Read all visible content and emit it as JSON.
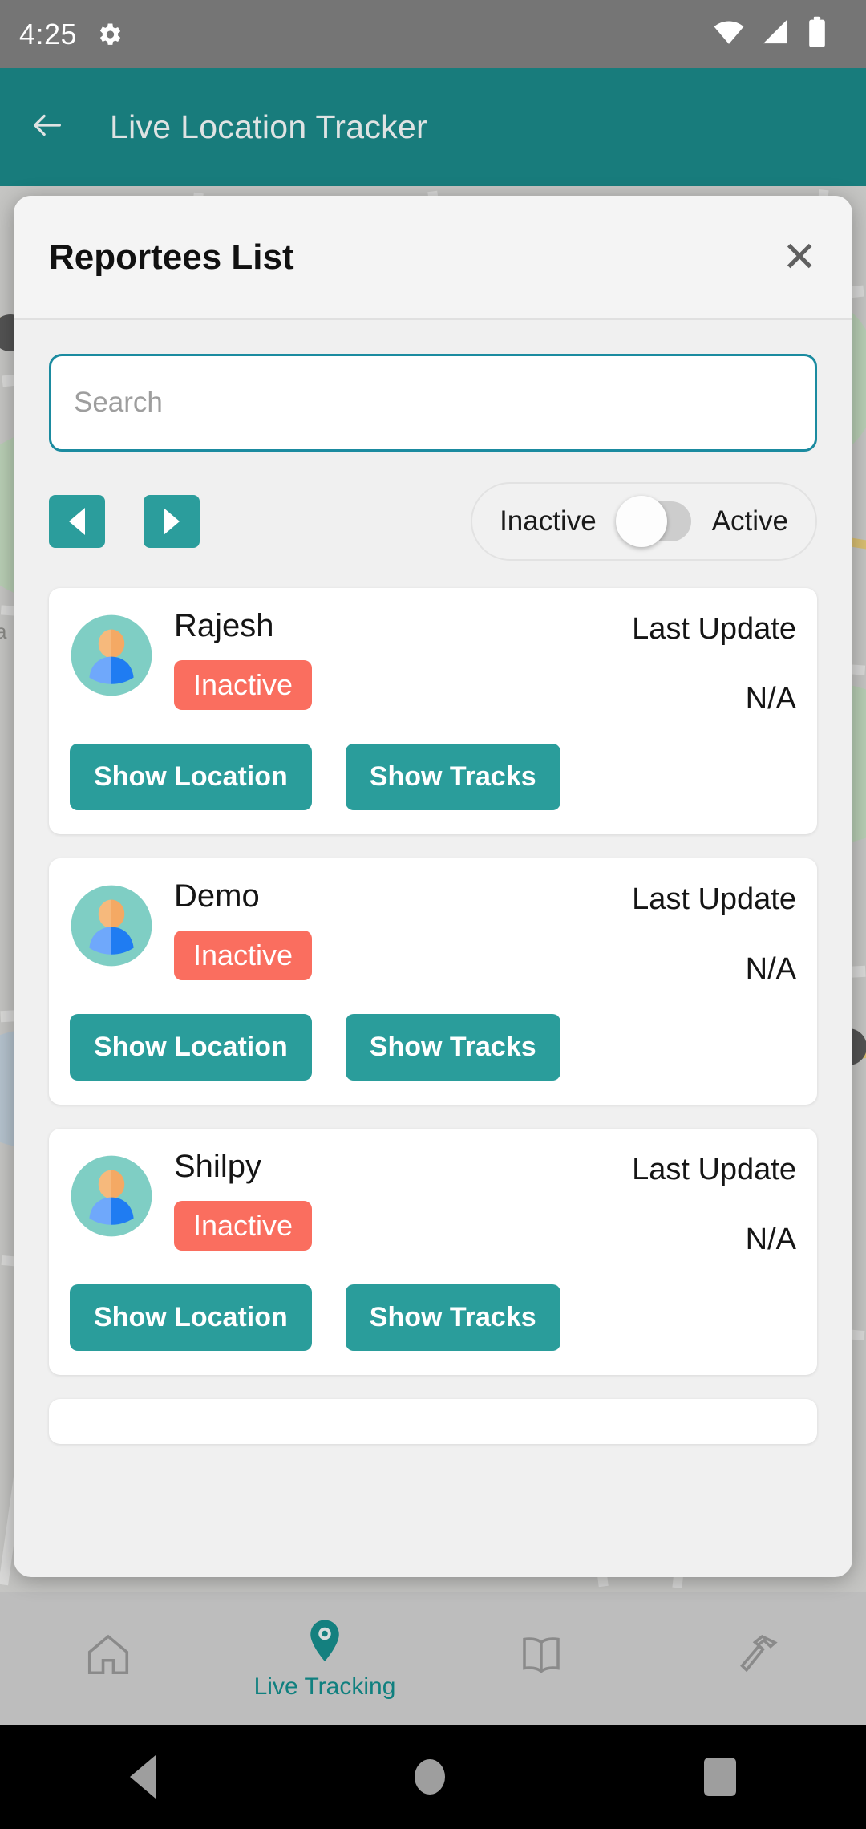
{
  "status_bar": {
    "time": "4:25",
    "left_icons": [
      "gear-icon"
    ],
    "right_icons": [
      "wifi-icon",
      "cellular-signal-icon",
      "battery-icon"
    ]
  },
  "app_bar": {
    "back_icon": "arrow-left-icon",
    "title": "Live Location Tracker"
  },
  "dialog": {
    "title": "Reportees List",
    "close_icon": "close-icon",
    "search": {
      "placeholder": "Search",
      "value": ""
    },
    "pagination": {
      "prev_icon": "chevron-left-icon",
      "next_icon": "chevron-right-icon"
    },
    "status_toggle": {
      "left_label": "Inactive",
      "right_label": "Active",
      "selected": "Inactive",
      "knob_position": "left"
    },
    "reportees": [
      {
        "name": "Rajesh",
        "status": "Inactive",
        "last_update_label": "Last Update",
        "last_update_value": "N/A",
        "show_location_label": "Show Location",
        "show_tracks_label": "Show Tracks"
      },
      {
        "name": "Demo",
        "status": "Inactive",
        "last_update_label": "Last Update",
        "last_update_value": "N/A",
        "show_location_label": "Show Location",
        "show_tracks_label": "Show Tracks"
      },
      {
        "name": "Shilpy",
        "status": "Inactive",
        "last_update_label": "Last Update",
        "last_update_value": "N/A",
        "show_location_label": "Show Location",
        "show_tracks_label": "Show Tracks"
      }
    ]
  },
  "bottom_nav": {
    "items": [
      {
        "icon": "home-icon",
        "label": "",
        "active": false
      },
      {
        "icon": "location-pin-icon",
        "label": "Live Tracking",
        "active": true
      },
      {
        "icon": "book-icon",
        "label": "",
        "active": false
      },
      {
        "icon": "hammer-icon",
        "label": "",
        "active": false
      }
    ]
  },
  "android_nav": {
    "back_icon": "android-back-icon",
    "home_icon": "android-home-icon",
    "recents_icon": "android-recents-icon"
  },
  "colors": {
    "app_bar": "#187c7c",
    "accent_teal": "#2a9d9b",
    "badge_inactive": "#fa6e5f",
    "search_border": "#1b8ba0",
    "status_bar": "#757575",
    "dialog_bg": "#f0f0f0"
  }
}
